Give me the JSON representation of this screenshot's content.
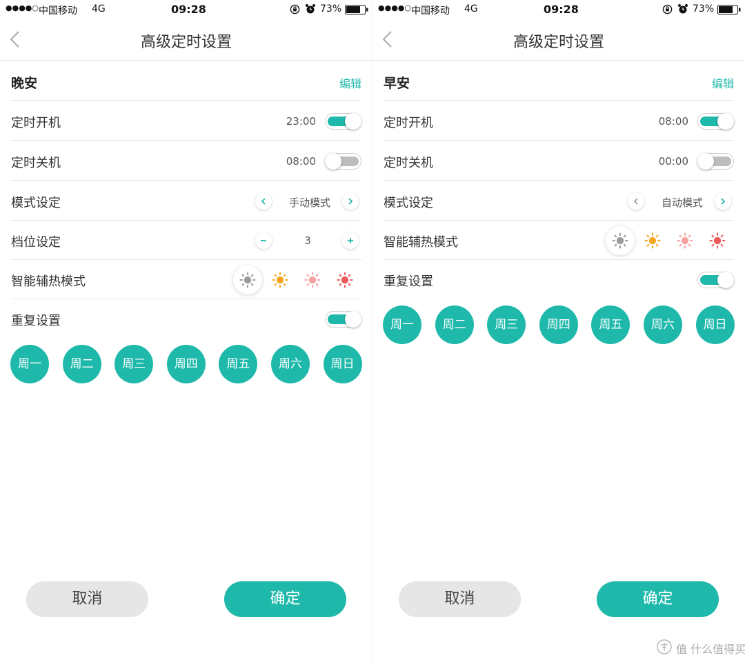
{
  "status_bar": {
    "signal": "●●●●○",
    "carrier": "中国移动",
    "network": "4G",
    "time": "09:28",
    "battery": "73%"
  },
  "screens": [
    {
      "title": "高级定时设置",
      "preset_name": "晚安",
      "edit_label": "编辑",
      "power_on": {
        "label": "定时开机",
        "time": "23:00",
        "enabled": true
      },
      "power_off": {
        "label": "定时关机",
        "time": "08:00",
        "enabled": false
      },
      "mode": {
        "label": "模式设定",
        "value": "手动模式"
      },
      "level": {
        "label": "档位设定",
        "value": "3"
      },
      "heat": {
        "label": "智能辅热模式",
        "selected_index": 0
      },
      "repeat": {
        "label": "重复设置",
        "enabled": true
      },
      "days": [
        "周一",
        "周二",
        "周三",
        "周四",
        "周五",
        "周六",
        "周日"
      ],
      "cancel_label": "取消",
      "confirm_label": "确定"
    },
    {
      "title": "高级定时设置",
      "preset_name": "早安",
      "edit_label": "编辑",
      "power_on": {
        "label": "定时开机",
        "time": "08:00",
        "enabled": true
      },
      "power_off": {
        "label": "定时关机",
        "time": "00:00",
        "enabled": false
      },
      "mode": {
        "label": "模式设定",
        "value": "自动模式"
      },
      "heat": {
        "label": "智能辅热模式",
        "selected_index": 0
      },
      "repeat": {
        "label": "重复设置",
        "enabled": true
      },
      "days": [
        "周一",
        "周二",
        "周三",
        "周四",
        "周五",
        "周六",
        "周日"
      ],
      "cancel_label": "取消",
      "confirm_label": "确定"
    }
  ],
  "heat_icons": [
    {
      "name": "sun-gray-icon",
      "color": "#9a9a9a"
    },
    {
      "name": "sun-orange-icon",
      "color": "#f5a623"
    },
    {
      "name": "sun-pink-icon",
      "color": "#f7a1a1"
    },
    {
      "name": "sun-red-icon",
      "color": "#ee5a5a"
    }
  ],
  "colors": {
    "accent": "#1fb9ab",
    "cancel_bg": "#e6e6e6"
  },
  "watermark": "值 什么值得买"
}
